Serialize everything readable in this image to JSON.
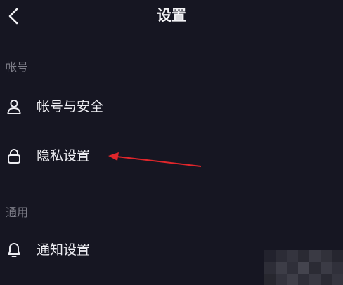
{
  "header": {
    "title": "设置",
    "back_icon": "chevron-left-icon"
  },
  "sections": [
    {
      "label": "帐号",
      "items": [
        {
          "label": "帐号与安全",
          "icon": "user-icon"
        },
        {
          "label": "隐私设置",
          "icon": "lock-icon"
        }
      ]
    },
    {
      "label": "通用",
      "items": [
        {
          "label": "通知设置",
          "icon": "bell-icon"
        }
      ]
    }
  ],
  "annotation": {
    "arrow_color": "#e0262b",
    "points_to": "隐私设置"
  },
  "colors": {
    "background": "#161622",
    "text_primary": "#ededf2",
    "text_secondary": "#7d7d88"
  }
}
